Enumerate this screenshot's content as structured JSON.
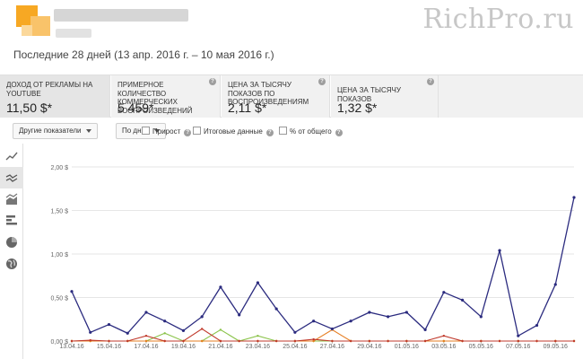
{
  "header": {
    "watermark": "RichPro.ru",
    "period": "Последние 28 дней (13 апр. 2016 г. – 10 мая 2016 г.)"
  },
  "metrics": [
    {
      "label": "ДОХОД ОТ РЕКЛАМЫ НА YOUTUBE",
      "value": "11,50 $*",
      "active": true
    },
    {
      "label": "ПРИМЕРНОЕ КОЛИЧЕСТВО КОММЕРЧЕСКИХ ВОСПРОИЗВЕДЕНИЙ",
      "value": "5 459*",
      "active": false
    },
    {
      "label": "ЦЕНА ЗА ТЫСЯЧУ ПОКАЗОВ ПО ВОСПРОИЗВЕДЕНИЯМ",
      "value": "2,11 $*",
      "active": false
    },
    {
      "label": "ЦЕНА ЗА ТЫСЯЧУ ПОКАЗОВ",
      "value": "1,32 $*",
      "active": false
    }
  ],
  "controls": {
    "other_metrics": "Другие показатели",
    "by_days": "По дням",
    "growth": "Прирост",
    "totals": "Итоговые данные",
    "percent_total": "% от общего"
  },
  "sidebar": [
    "line-chart-icon",
    "multi-line-chart-icon",
    "stacked-area-icon",
    "bar-chart-icon",
    "pie-chart-icon",
    "globe-icon"
  ],
  "chart_data": {
    "type": "line",
    "x": [
      "13.04.16",
      "14.04.16",
      "15.04.16",
      "16.04.16",
      "17.04.16",
      "18.04.16",
      "19.04.16",
      "20.04.16",
      "21.04.16",
      "22.04.16",
      "23.04.16",
      "24.04.16",
      "25.04.16",
      "26.04.16",
      "27.04.16",
      "28.04.16",
      "29.04.16",
      "30.04.16",
      "01.05.16",
      "02.05.16",
      "03.05.16",
      "04.05.16",
      "05.05.16",
      "06.05.16",
      "07.05.16",
      "08.05.16",
      "09.05.16",
      "10.05.16"
    ],
    "tick_labels": [
      "13.04.16",
      "15.04.16",
      "17.04.16",
      "19.04.16",
      "21.04.16",
      "23.04.16",
      "25.04.16",
      "27.04.16",
      "29.04.16",
      "01.05.16",
      "03.05.16",
      "05.05.16",
      "07.05.16",
      "09.05.16"
    ],
    "y_ticks": [
      "0,00 $",
      "0,50 $",
      "1,00 $",
      "1,50 $",
      "2,00 $"
    ],
    "ylim": [
      0,
      2.0
    ],
    "grid": true,
    "series": [
      {
        "color": "#2b2b7f",
        "values": [
          0.57,
          0.1,
          0.19,
          0.09,
          0.33,
          0.23,
          0.12,
          0.28,
          0.62,
          0.3,
          0.67,
          0.37,
          0.1,
          0.23,
          0.14,
          0.23,
          0.33,
          0.28,
          0.33,
          0.13,
          0.56,
          0.47,
          0.28,
          1.04,
          0.06,
          0.18,
          0.65,
          1.65
        ]
      },
      {
        "color": "#c0392b",
        "values": [
          0.0,
          0.01,
          0.0,
          0.0,
          0.06,
          0.0,
          0.0,
          0.14,
          0.0,
          0.0,
          0.0,
          0.0,
          0.0,
          0.02,
          0.0,
          0.0,
          0.0,
          0.0,
          0.0,
          0.0,
          0.06,
          0.0,
          0.0,
          0.0,
          0.0,
          0.0,
          0.0,
          0.0
        ]
      },
      {
        "color": "#e67e22",
        "values": [
          0.0,
          0.0,
          0.0,
          0.0,
          0.0,
          0.0,
          0.0,
          0.0,
          0.0,
          0.0,
          0.0,
          0.0,
          0.0,
          0.0,
          0.13,
          0.0,
          0.0,
          0.0,
          0.0,
          0.0,
          0.0,
          0.0,
          0.0,
          0.0,
          0.0,
          0.0,
          0.0,
          0.0
        ]
      },
      {
        "color": "#8bc34a",
        "values": [
          0.0,
          0.0,
          0.0,
          0.0,
          0.0,
          0.09,
          0.0,
          0.0,
          0.13,
          0.0,
          0.06,
          0.0,
          0.0,
          0.0,
          0.0,
          0.0,
          0.0,
          0.0,
          0.0,
          0.0,
          0.0,
          0.0,
          0.0,
          0.0,
          0.0,
          0.0,
          0.0,
          0.0
        ]
      },
      {
        "color": "#f1c40f",
        "values": [
          0.0,
          0.0,
          0.0,
          0.0,
          0.0,
          0.0,
          0.0,
          0.0,
          0.0,
          0.0,
          0.0,
          0.0,
          0.0,
          0.0,
          0.0,
          0.0,
          0.0,
          0.0,
          0.0,
          0.0,
          0.0,
          0.0,
          0.0,
          0.0,
          0.0,
          0.0,
          0.0,
          0.0
        ]
      }
    ]
  }
}
